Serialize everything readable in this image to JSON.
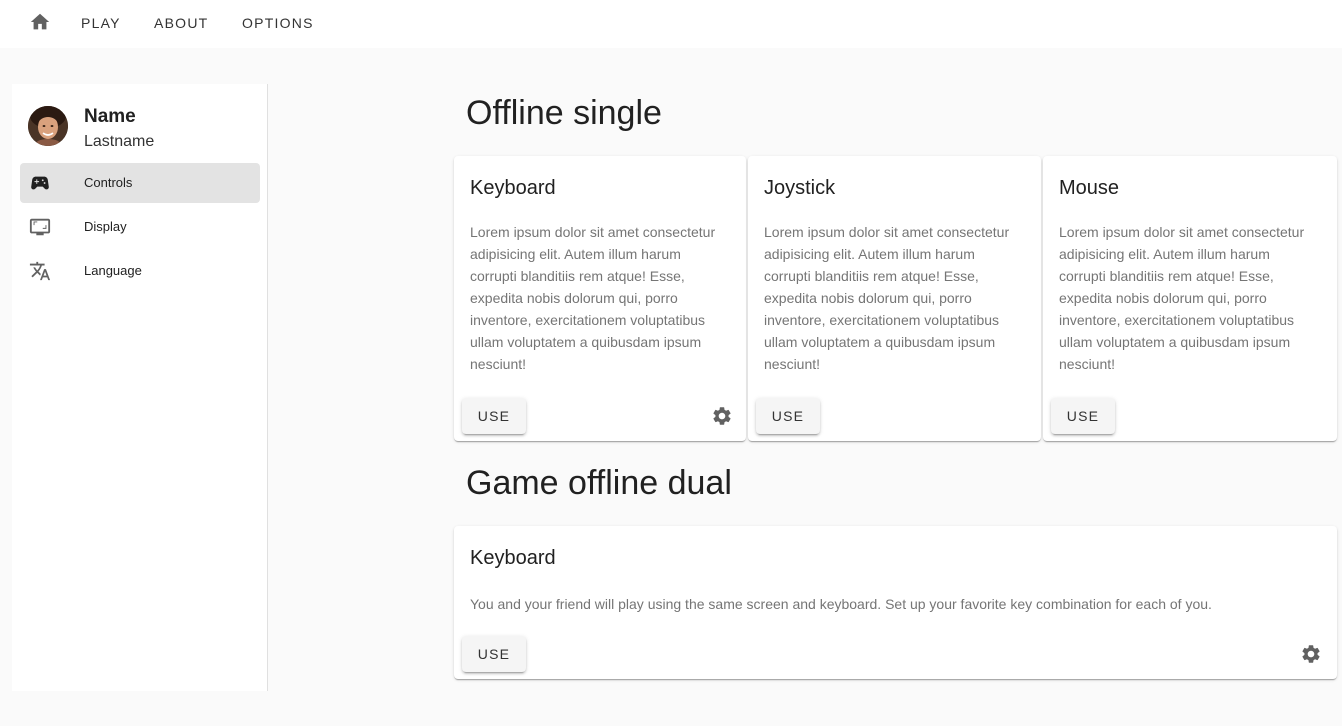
{
  "nav": {
    "home_icon": "home-icon",
    "links": [
      "PLAY",
      "ABOUT",
      "OPTIONS"
    ]
  },
  "user": {
    "name": "Name",
    "lastname": "Lastname"
  },
  "menu": [
    {
      "label": "Controls",
      "icon": "gamepad-icon",
      "active": true
    },
    {
      "label": "Display",
      "icon": "monitor-icon",
      "active": false
    },
    {
      "label": "Language",
      "icon": "translate-icon",
      "active": false
    }
  ],
  "sections": {
    "single": {
      "title": "Offline single",
      "cards": [
        {
          "title": "Keyboard",
          "text": "Lorem ipsum dolor sit amet consectetur adipisicing elit. Autem illum harum corrupti blanditiis rem atque! Esse, expedita nobis dolorum qui, porro inventore, exercitationem voluptatibus ullam voluptatem a quibusdam ipsum nesciunt!",
          "button": "USE",
          "has_settings": true
        },
        {
          "title": "Joystick",
          "text": "Lorem ipsum dolor sit amet consectetur adipisicing elit. Autem illum harum corrupti blanditiis rem atque! Esse, expedita nobis dolorum qui, porro inventore, exercitationem voluptatibus ullam voluptatem a quibusdam ipsum nesciunt!",
          "button": "USE",
          "has_settings": false
        },
        {
          "title": "Mouse",
          "text": "Lorem ipsum dolor sit amet consectetur adipisicing elit. Autem illum harum corrupti blanditiis rem atque! Esse, expedita nobis dolorum qui, porro inventore, exercitationem voluptatibus ullam voluptatem a quibusdam ipsum nesciunt!",
          "button": "USE",
          "has_settings": false
        }
      ]
    },
    "dual": {
      "title": "Game offline dual",
      "cards": [
        {
          "title": "Keyboard",
          "text": "You and your friend will play using the same screen and keyboard. Set up your favorite key combination for each of you.",
          "button": "USE",
          "has_settings": true
        }
      ]
    }
  },
  "colors": {
    "icon": "#616161",
    "active_bg": "#e3e3e3",
    "page_bg": "#fafafa"
  }
}
